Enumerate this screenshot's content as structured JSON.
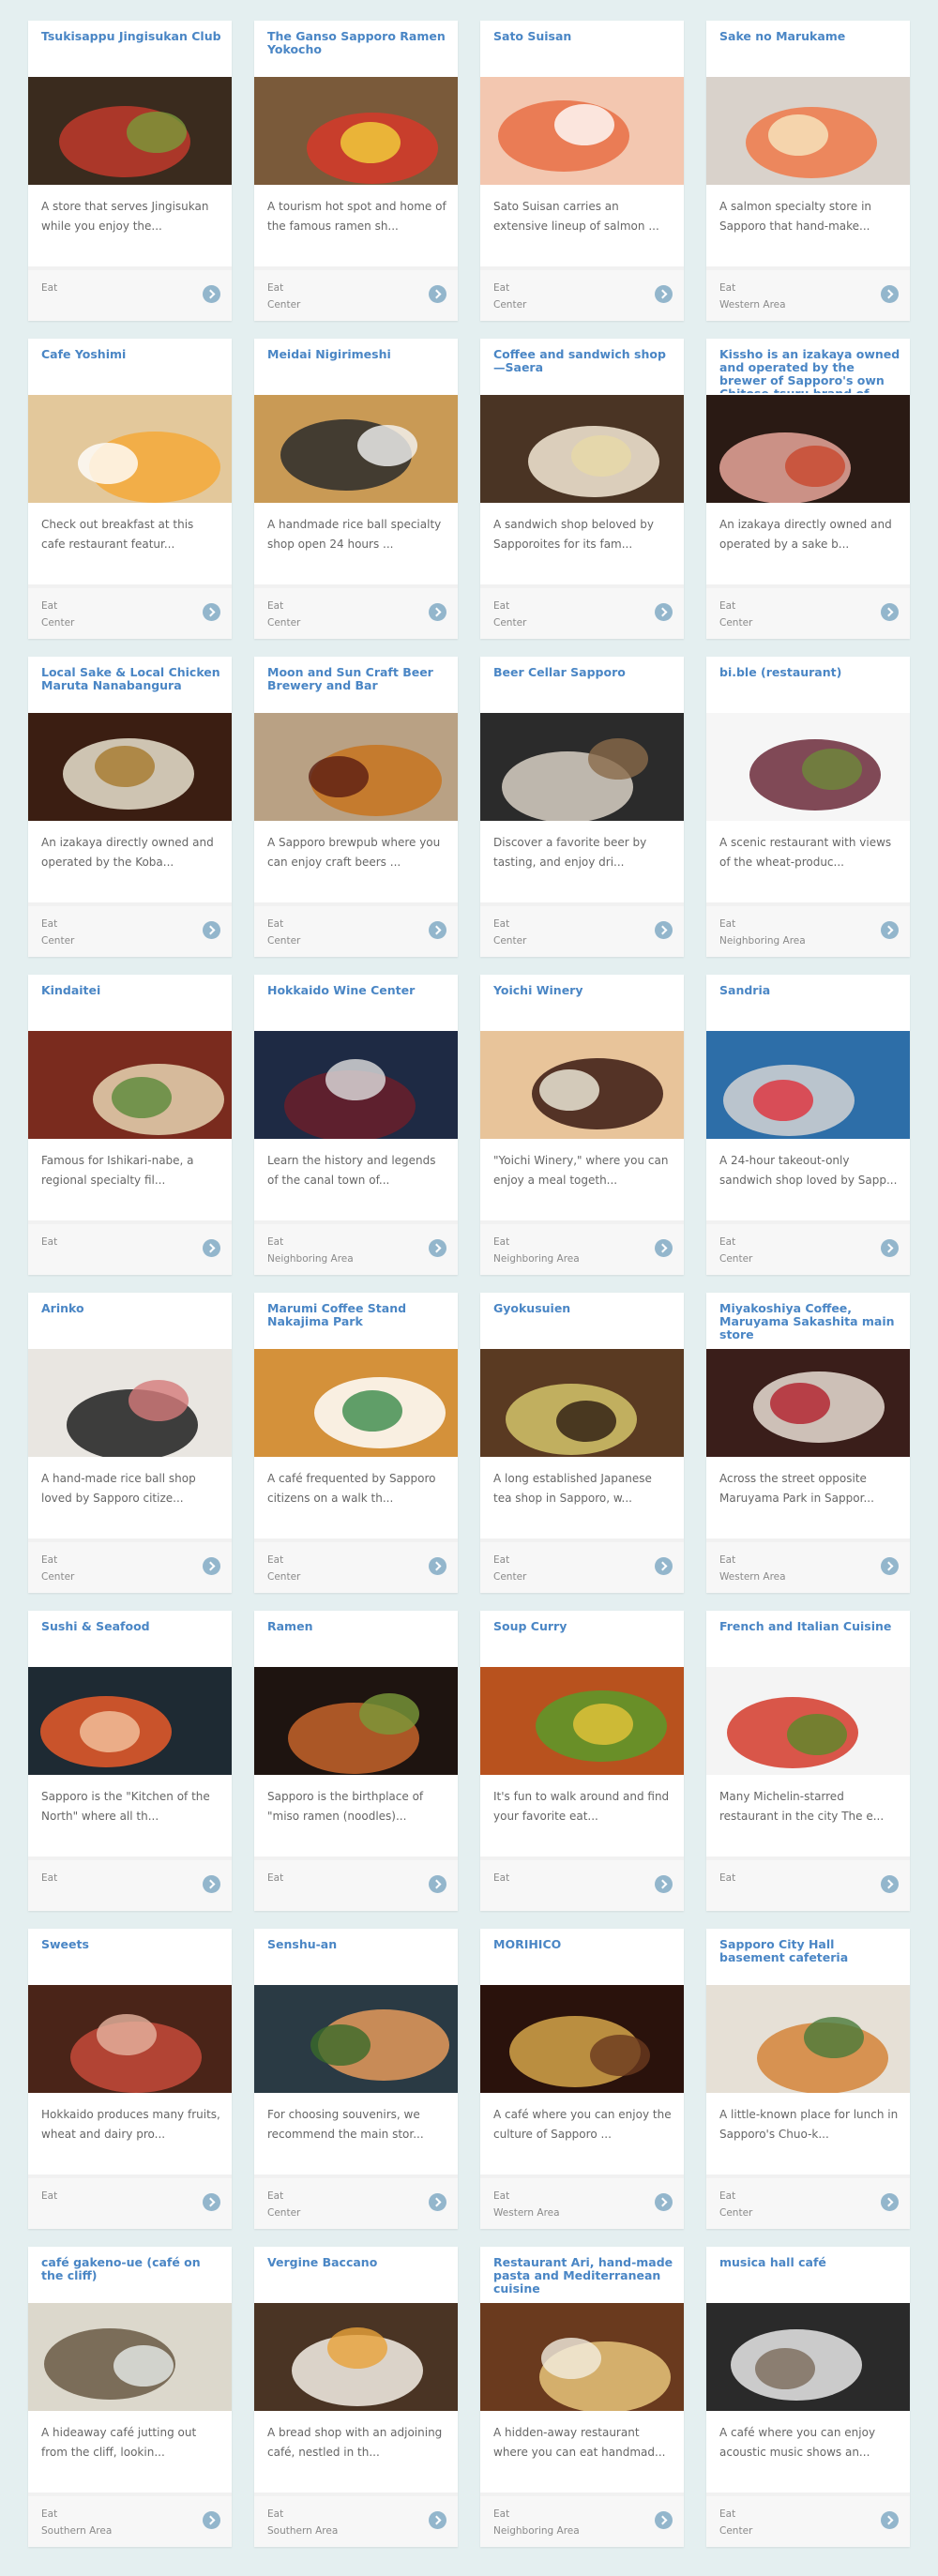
{
  "cards": [
    {
      "title": "Tsukisappu Jingisukan Club",
      "desc": "A store that serves Jingisukan while you enjoy the...",
      "category": "Eat",
      "area": "",
      "image": "jingisukan-grill-photo",
      "colors": [
        "#3a2b1e",
        "#c0392b",
        "#7a9a3a"
      ]
    },
    {
      "title": "The Ganso Sapporo Ramen Yokocho",
      "desc": "A tourism hot spot and home of the famous ramen sh...",
      "category": "Eat",
      "area": "Center",
      "image": "ramen-alley-sign-photo",
      "colors": [
        "#7a5a3a",
        "#d63a2a",
        "#f2d23c"
      ]
    },
    {
      "title": "Sato Suisan",
      "desc": "Sato Suisan carries an extensive lineup of salmon ...",
      "category": "Eat",
      "area": "Center",
      "image": "salmon-fillet-photo",
      "colors": [
        "#f3c7b0",
        "#e86e45",
        "#ffffff"
      ]
    },
    {
      "title": "Sake no Marukame",
      "desc": "A salmon specialty store in Sapporo that hand-make...",
      "category": "Eat",
      "area": "Western Area",
      "image": "salmon-sashimi-photo",
      "colors": [
        "#d9d2cb",
        "#ef7a4a",
        "#f7e7c0"
      ]
    },
    {
      "title": "Cafe Yoshimi",
      "desc": "Check out breakfast at this cafe restaurant featur...",
      "category": "Eat",
      "area": "Center",
      "image": "pancake-plate-photo",
      "colors": [
        "#e3c89b",
        "#f4a93a",
        "#ffffff"
      ]
    },
    {
      "title": "Meidai Nigirimeshi",
      "desc": "A handmade rice ball specialty shop open 24 hours ...",
      "category": "Eat",
      "area": "Center",
      "image": "rice-ball-plate-photo",
      "colors": [
        "#c99a55",
        "#2b2b2b",
        "#f5f5f5"
      ]
    },
    {
      "title": "Coffee and sandwich shop—Saera",
      "desc": "A sandwich shop beloved by Sapporoites for its fam...",
      "category": "Eat",
      "area": "Center",
      "image": "sandwich-photo",
      "colors": [
        "#4a3424",
        "#f4ead6",
        "#e7d9a8"
      ]
    },
    {
      "title": "Kissho is an izakaya owned and operated by the brewer of Sapporo's own Chitose-tsuru brand of sake",
      "desc": "An izakaya directly owned and operated by a sake b...",
      "category": "Eat",
      "area": "Center",
      "image": "hotpot-meat-photo",
      "colors": [
        "#2a1a14",
        "#e7a79a",
        "#c8472d"
      ]
    },
    {
      "title": "Local Sake & Local Chicken Maruta Nanabangura",
      "desc": "An izakaya directly owned and operated by the Koba...",
      "category": "Eat",
      "area": "Center",
      "image": "sake-bottles-photo",
      "colors": [
        "#3b1e12",
        "#e9e2cf",
        "#a6792c"
      ]
    },
    {
      "title": "Moon and Sun Craft Beer Brewery and Bar",
      "desc": "A Sapporo brewpub where you can enjoy craft beers ...",
      "category": "Eat",
      "area": "Center",
      "image": "craft-beer-glasses-photo",
      "colors": [
        "#b9a184",
        "#c7741e",
        "#5a1d12"
      ]
    },
    {
      "title": "Beer Cellar Sapporo",
      "desc": "Discover a favorite beer by tasting, and enjoy dri...",
      "category": "Eat",
      "area": "Center",
      "image": "beer-bar-counter-photo",
      "colors": [
        "#2b2b2b",
        "#d8d0c4",
        "#8a6a4a"
      ]
    },
    {
      "title": "bi.ble (restaurant)",
      "desc": "A scenic restaurant with views of the wheat-produc...",
      "category": "Eat",
      "area": "Neighboring Area",
      "image": "plated-dish-photo",
      "colors": [
        "#f6f6f6",
        "#6b2a3a",
        "#6d8a3a"
      ]
    },
    {
      "title": "Kindaitei",
      "desc": "Famous for Ishikari-nabe, a regional specialty fil...",
      "category": "Eat",
      "area": "",
      "image": "nabe-hotpot-photo",
      "colors": [
        "#7a2b1e",
        "#e6d3b2",
        "#5a8a3a"
      ]
    },
    {
      "title": "Hokkaido Wine Center",
      "desc": "Learn the history and legends of the canal town of...",
      "category": "Eat",
      "area": "Neighboring Area",
      "image": "wine-pouring-photo",
      "colors": [
        "#1e2a44",
        "#6a1e2a",
        "#e0e0e0"
      ]
    },
    {
      "title": "Yoichi Winery",
      "desc": "\"Yoichi Winery,\" where you can enjoy a meal togeth...",
      "category": "Eat",
      "area": "Neighboring Area",
      "image": "wine-bottle-glass-photo",
      "colors": [
        "#e8c49a",
        "#3a1a12",
        "#f2f0e0"
      ]
    },
    {
      "title": "Sandria",
      "desc": "A 24-hour takeout-only sandwich shop loved by Sapp...",
      "category": "Eat",
      "area": "Center",
      "image": "shop-front-photo",
      "colors": [
        "#2d6ea8",
        "#d4d4d4",
        "#e0303a"
      ]
    },
    {
      "title": "Arinko",
      "desc": "A hand-made rice ball shop loved by Sapporo citize...",
      "category": "Eat",
      "area": "Center",
      "image": "rice-ball-dishes-photo",
      "colors": [
        "#e9e6e1",
        "#1e1e1e",
        "#d47a7a"
      ]
    },
    {
      "title": "Marumi Coffee Stand Nakajima Park",
      "desc": "A café frequented by Sapporo citizens on a walk th...",
      "category": "Eat",
      "area": "Center",
      "image": "waffle-latte-photo",
      "colors": [
        "#d4913a",
        "#ffffff",
        "#3a8a4a"
      ]
    },
    {
      "title": "Gyokusuien",
      "desc": "A long established Japanese tea shop in Sapporo, w...",
      "category": "Eat",
      "area": "Center",
      "image": "japanese-tea-photo",
      "colors": [
        "#5a3a22",
        "#d4c46a",
        "#2a1a10"
      ]
    },
    {
      "title": "Miyakoshiya Coffee, Maruyama Sakashita main store",
      "desc": "Across the street opposite Maruyama Park in Sappor...",
      "category": "Eat",
      "area": "Western Area",
      "image": "coffee-pour-photo",
      "colors": [
        "#3a1e1a",
        "#e7ddd3",
        "#b21e2a"
      ]
    },
    {
      "title": "Sushi & Seafood",
      "desc": "Sapporo is the \"Kitchen of the North\" where all th...",
      "category": "Eat",
      "area": "",
      "image": "seafood-bowl-photo",
      "colors": [
        "#1e2a33",
        "#e85a2a",
        "#f4c4a0"
      ]
    },
    {
      "title": "Ramen",
      "desc": "Sapporo is the birthplace of \"miso ramen (noodles)...",
      "category": "Eat",
      "area": "",
      "image": "ramen-bowl-photo",
      "colors": [
        "#1e1410",
        "#c4632a",
        "#7a9a3a"
      ]
    },
    {
      "title": "Soup Curry",
      "desc": "It's fun to walk around and find your favorite eat...",
      "category": "Eat",
      "area": "",
      "image": "soup-curry-photo",
      "colors": [
        "#b8521e",
        "#5a9a2a",
        "#e6c43a"
      ]
    },
    {
      "title": "French and Italian Cuisine",
      "desc": "Many Michelin-starred restaurant in the city The e...",
      "category": "Eat",
      "area": "",
      "image": "fine-dining-plate-photo",
      "colors": [
        "#f4f4f4",
        "#d43a2a",
        "#5a8a2a"
      ]
    },
    {
      "title": "Sweets",
      "desc": "Hokkaido produces many fruits, wheat and dairy pro...",
      "category": "Eat",
      "area": "",
      "image": "chocolate-pastries-photo",
      "colors": [
        "#4a2418",
        "#c44a3a",
        "#e6b4a0"
      ]
    },
    {
      "title": "Senshu-an",
      "desc": "For choosing souvenirs, we recommend the main stor...",
      "category": "Eat",
      "area": "Center",
      "image": "senbei-plate-photo",
      "colors": [
        "#2a3a44",
        "#e49a5a",
        "#3a6a2a"
      ]
    },
    {
      "title": "MORIHICO",
      "desc": "A café where you can enjoy the culture of Sapporo ...",
      "category": "Eat",
      "area": "Western Area",
      "image": "cafe-interior-photo",
      "colors": [
        "#2a120c",
        "#d4a44a",
        "#6a3a1e"
      ]
    },
    {
      "title": "Sapporo City Hall basement cafeteria",
      "desc": "A little-known place for lunch in Sapporo's Chuo-k...",
      "category": "Eat",
      "area": "Center",
      "image": "cafeteria-meal-photo",
      "colors": [
        "#e6e0d6",
        "#d4843a",
        "#4a7a3a"
      ]
    },
    {
      "title": "café gakeno-ue (café on the cliff)",
      "desc": "A hideaway café jutting out from the cliff, lookin...",
      "category": "Eat",
      "area": "Southern Area",
      "image": "cliff-cafe-window-photo",
      "colors": [
        "#dcd8cc",
        "#6a5a44",
        "#e8ecea"
      ]
    },
    {
      "title": "Vergine Baccano",
      "desc": "A bread shop with an adjoining café, nestled in th...",
      "category": "Eat",
      "area": "Southern Area",
      "image": "breakfast-plate-photo",
      "colors": [
        "#4a3424",
        "#f4f0e6",
        "#e9a23a"
      ]
    },
    {
      "title": "Restaurant Ari, hand-made pasta and Mediterranean cuisine",
      "desc": "A hidden-away restaurant where you can eat handmad...",
      "category": "Eat",
      "area": "Neighboring Area",
      "image": "restaurant-table-photo",
      "colors": [
        "#6a3a1e",
        "#e6c47a",
        "#f2ede0"
      ]
    },
    {
      "title": "musica hall café",
      "desc": "A café where you can enjoy acoustic music shows an...",
      "category": "Eat",
      "area": "Center",
      "image": "music-hall-piano-photo",
      "colors": [
        "#2a2a2a",
        "#e8e8e8",
        "#7a6a5a"
      ]
    }
  ]
}
